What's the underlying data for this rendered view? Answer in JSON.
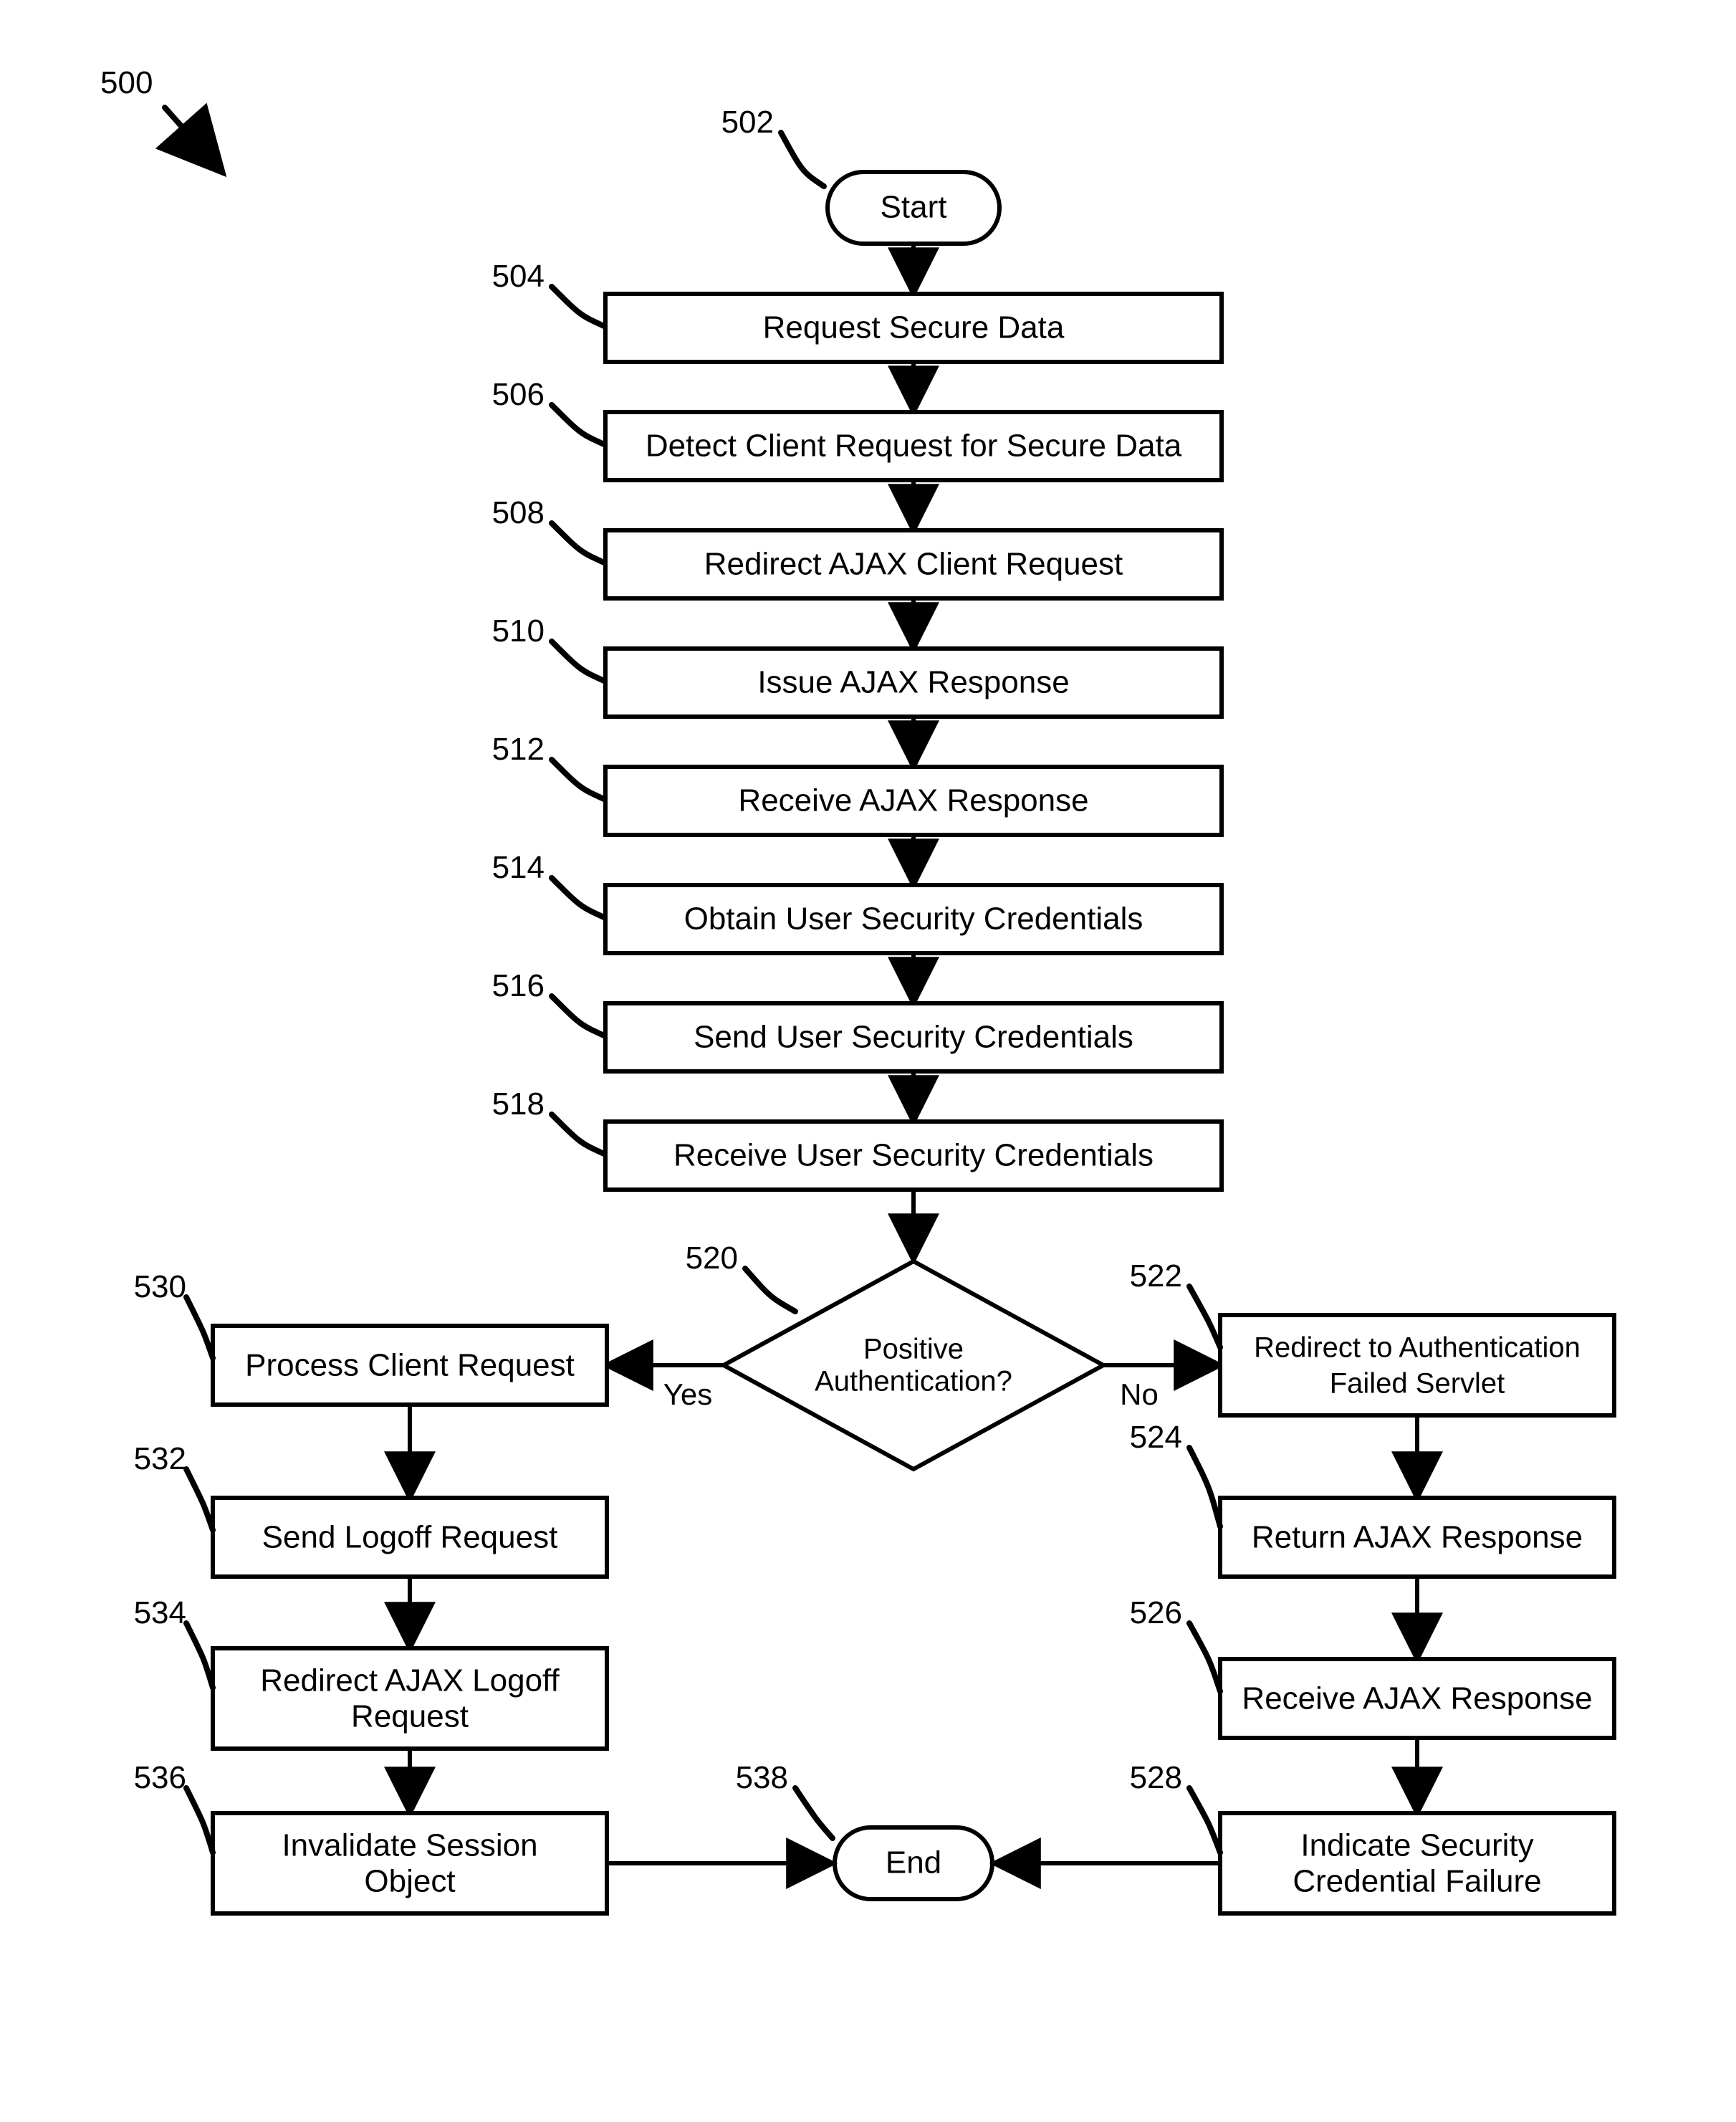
{
  "figure_label": "500",
  "nodes": {
    "start": {
      "num": "502",
      "text": "Start"
    },
    "n504": {
      "num": "504",
      "text": "Request Secure Data"
    },
    "n506": {
      "num": "506",
      "text": "Detect Client Request for Secure Data"
    },
    "n508": {
      "num": "508",
      "text": "Redirect AJAX Client Request"
    },
    "n510": {
      "num": "510",
      "text": "Issue AJAX Response"
    },
    "n512": {
      "num": "512",
      "text": "Receive AJAX Response"
    },
    "n514": {
      "num": "514",
      "text": "Obtain User Security Credentials"
    },
    "n516": {
      "num": "516",
      "text": "Send User Security Credentials"
    },
    "n518": {
      "num": "518",
      "text": "Receive User Security Credentials"
    },
    "dec": {
      "num": "520",
      "text1": "Positive",
      "text2": "Authentication?"
    },
    "n530": {
      "num": "530",
      "text": "Process Client Request"
    },
    "n532": {
      "num": "532",
      "text": "Send Logoff Request"
    },
    "n534": {
      "num": "534",
      "text1": "Redirect AJAX Logoff",
      "text2": "Request"
    },
    "n536": {
      "num": "536",
      "text1": "Invalidate Session",
      "text2": "Object"
    },
    "n522": {
      "num": "522",
      "text1": "Redirect to Authentication",
      "text2": "Failed Servlet"
    },
    "n524": {
      "num": "524",
      "text": "Return AJAX Response"
    },
    "n526": {
      "num": "526",
      "text": "Receive AJAX Response"
    },
    "n528": {
      "num": "528",
      "text1": "Indicate Security",
      "text2": "Credential Failure"
    },
    "end": {
      "num": "538",
      "text": "End"
    }
  },
  "decision_labels": {
    "yes": "Yes",
    "no": "No"
  }
}
